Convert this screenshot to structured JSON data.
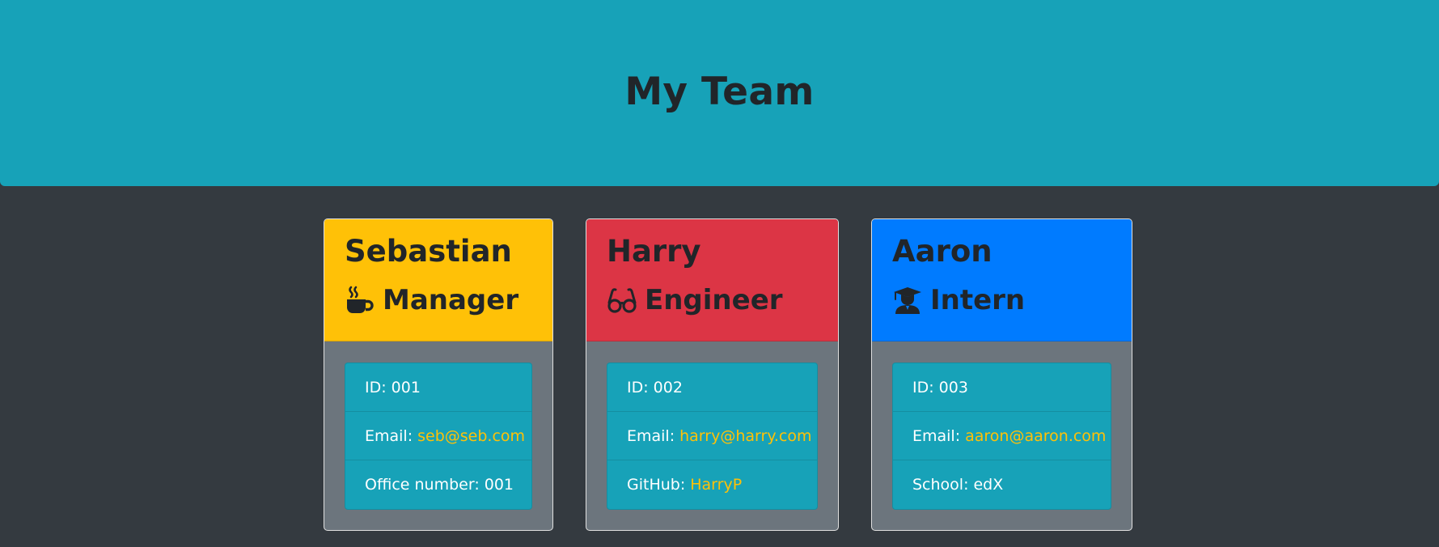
{
  "header": {
    "title": "My Team"
  },
  "colors": {
    "page_background": "#343a40",
    "header_background": "#17a2b8",
    "card_body": "#6c757d",
    "list_background": "#17a2b8",
    "link": "#ffc107",
    "manager_header": "#ffc107",
    "engineer_header": "#dc3545",
    "intern_header": "#007bff"
  },
  "cards": [
    {
      "name": "Sebastian",
      "role": "Manager",
      "role_icon": "coffee-mug-icon",
      "id_label": "ID:",
      "id_value": "001",
      "email_label": "Email:",
      "email": "seb@seb.com",
      "extra_label": "Office number:",
      "extra_value": "001"
    },
    {
      "name": "Harry",
      "role": "Engineer",
      "role_icon": "glasses-icon",
      "id_label": "ID:",
      "id_value": "002",
      "email_label": "Email:",
      "email": "harry@harry.com",
      "extra_label": "GitHub:",
      "extra_value": "HarryP"
    },
    {
      "name": "Aaron",
      "role": "Intern",
      "role_icon": "graduate-icon",
      "id_label": "ID:",
      "id_value": "003",
      "email_label": "Email:",
      "email": "aaron@aaron.com",
      "extra_label": "School:",
      "extra_value": "edX"
    }
  ]
}
